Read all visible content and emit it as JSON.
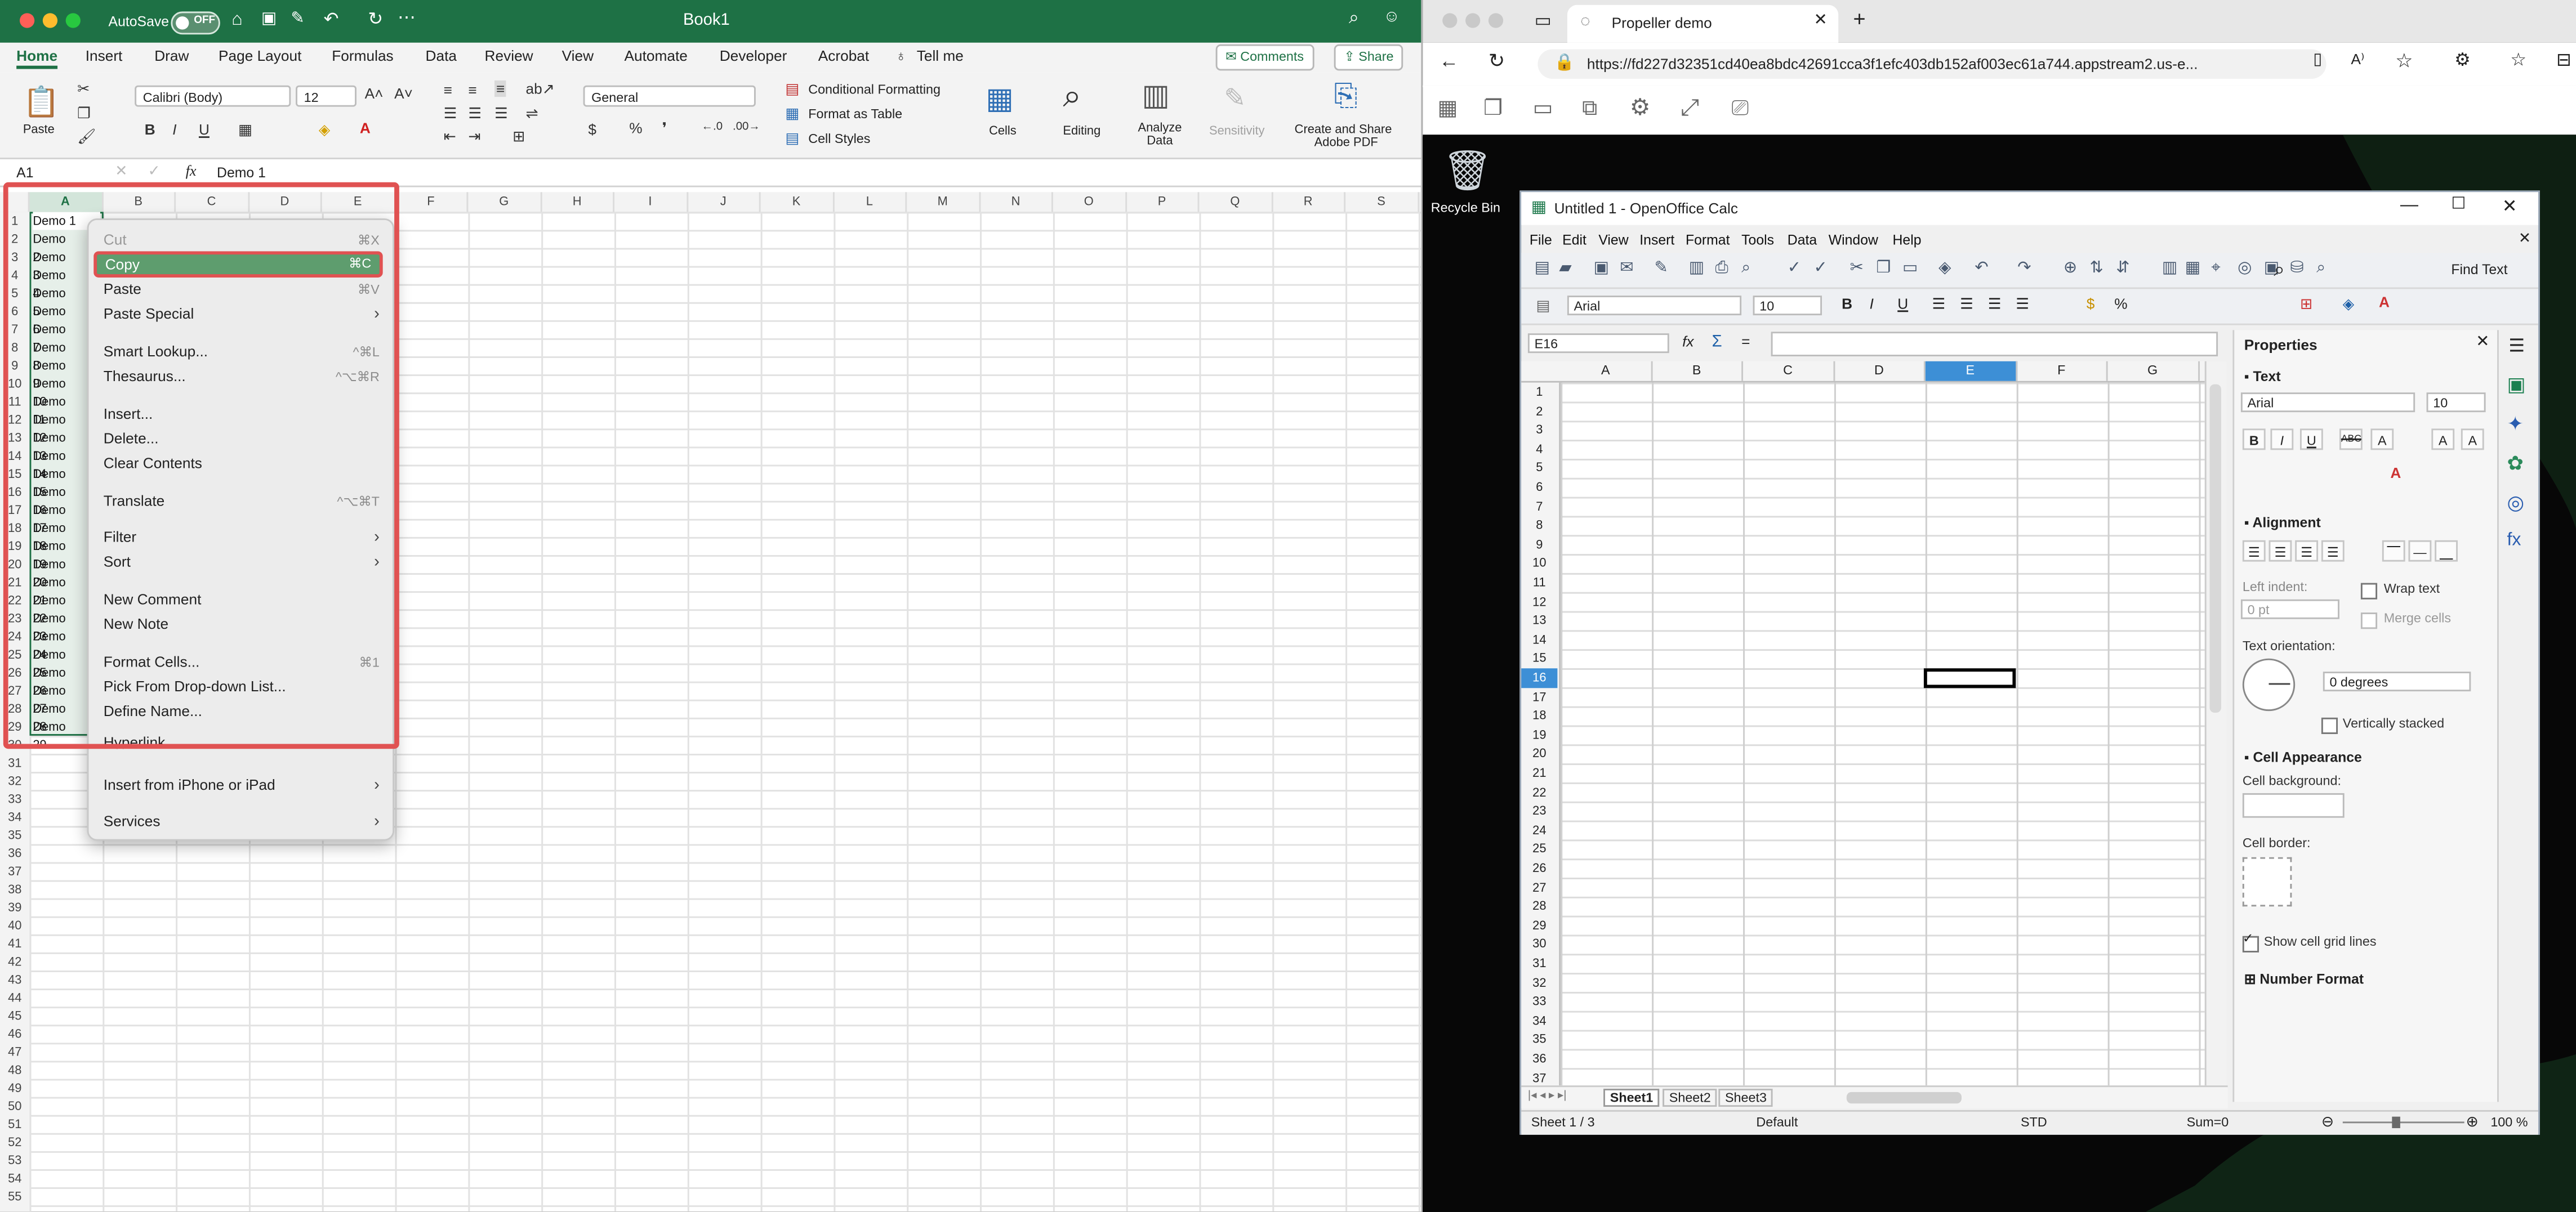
{
  "excel": {
    "autosave_label": "AutoSave",
    "autosave_state": "OFF",
    "book_title": "Book1",
    "tabs": [
      "Home",
      "Insert",
      "Draw",
      "Page Layout",
      "Formulas",
      "Data",
      "Review",
      "View",
      "Automate",
      "Developer",
      "Acrobat",
      "Tell me"
    ],
    "comments_label": "Comments",
    "share_label": "Share",
    "paste_label": "Paste",
    "font_name": "Calibri (Body)",
    "font_size": "12",
    "number_format": "General",
    "conditional_formatting": "Conditional Formatting",
    "format_as_table": "Format as Table",
    "cell_styles": "Cell Styles",
    "cells_label": "Cells",
    "editing_label": "Editing",
    "analyze_data": "Analyze Data",
    "sensitivity": "Sensitivity",
    "create_share_pdf_1": "Create and Share",
    "create_share_pdf_2": "Adobe PDF",
    "name_box": "A1",
    "formula_value": "Demo 1",
    "fx_label": "fx",
    "columns": [
      "A",
      "B",
      "C",
      "D",
      "E",
      "F",
      "G",
      "H",
      "I",
      "J",
      "K",
      "L",
      "M",
      "N",
      "O",
      "P",
      "Q",
      "R",
      "S"
    ],
    "cells_col_a": [
      "Demo 1",
      "Demo 2",
      "Demo 3",
      "Demo 4",
      "Demo 5",
      "Demo 6",
      "Demo 7",
      "Demo 8",
      "Demo 9",
      "Demo 10",
      "Demo 11",
      "Demo 12",
      "Demo 13",
      "Demo 14",
      "Demo 15",
      "Demo 16",
      "Demo 17",
      "Demo 18",
      "Demo 19",
      "Demo 20",
      "Demo 21",
      "Demo 22",
      "Demo 23",
      "Demo 24",
      "Demo 25",
      "Demo 26",
      "Demo 27",
      "Demo 28",
      "Demo 29"
    ],
    "context_menu": {
      "cut": "Cut",
      "cut_sc": "⌘X",
      "copy": "Copy",
      "copy_sc": "⌘C",
      "paste": "Paste",
      "paste_sc": "⌘V",
      "paste_special": "Paste Special",
      "smart_lookup": "Smart Lookup...",
      "smart_lookup_sc": "^⌘L",
      "thesaurus": "Thesaurus...",
      "thesaurus_sc": "^⌥⌘R",
      "insert": "Insert...",
      "delete": "Delete...",
      "clear_contents": "Clear Contents",
      "translate": "Translate",
      "translate_sc": "^⌥⌘T",
      "filter": "Filter",
      "sort": "Sort",
      "new_comment": "New Comment",
      "new_note": "New Note",
      "format_cells": "Format Cells...",
      "format_cells_sc": "⌘1",
      "pick_dropdown": "Pick From Drop-down List...",
      "define_name": "Define Name...",
      "hyperlink": "Hyperlink...",
      "insert_iphone": "Insert from iPhone or iPad",
      "services": "Services"
    }
  },
  "browser": {
    "tab_title": "Propeller demo",
    "url": "https://fd227d32351cd40ea8bdc42691cca3f1efc403db152af003ec61a744.appstream2.us-e...",
    "recycle_bin": "Recycle Bin"
  },
  "openoffice": {
    "window_title": "Untitled 1 - OpenOffice Calc",
    "menus": [
      "File",
      "Edit",
      "View",
      "Insert",
      "Format",
      "Tools",
      "Data",
      "Window",
      "Help"
    ],
    "find_text": "Find Text",
    "font_name": "Arial",
    "font_size": "10",
    "cell_ref": "E16",
    "columns": [
      "A",
      "B",
      "C",
      "D",
      "E",
      "F",
      "G"
    ],
    "active_row": "16",
    "sheet_tabs": [
      "Sheet1",
      "Sheet2",
      "Sheet3"
    ],
    "status_sheet": "Sheet 1 / 3",
    "status_style": "Default",
    "status_mode": "STD",
    "status_sum": "Sum=0",
    "zoom": "100 %",
    "properties": {
      "title": "Properties",
      "text_section": "Text",
      "font_name": "Arial",
      "font_size": "10",
      "alignment_section": "Alignment",
      "left_indent": "Left indent:",
      "indent_value": "0 pt",
      "wrap_text": "Wrap text",
      "merge_cells": "Merge cells",
      "text_orientation": "Text orientation:",
      "degrees": "0 degrees",
      "vertically_stacked": "Vertically stacked",
      "cell_appearance": "Cell Appearance",
      "cell_background": "Cell background:",
      "cell_border": "Cell border:",
      "show_grid": "Show cell grid lines",
      "number_format": "Number Format"
    }
  },
  "colors": {
    "excel_green": "#1e7145",
    "highlight_red": "#e05252",
    "menu_highlight": "#5e9d6e",
    "oo_active": "#3d8fd6"
  }
}
